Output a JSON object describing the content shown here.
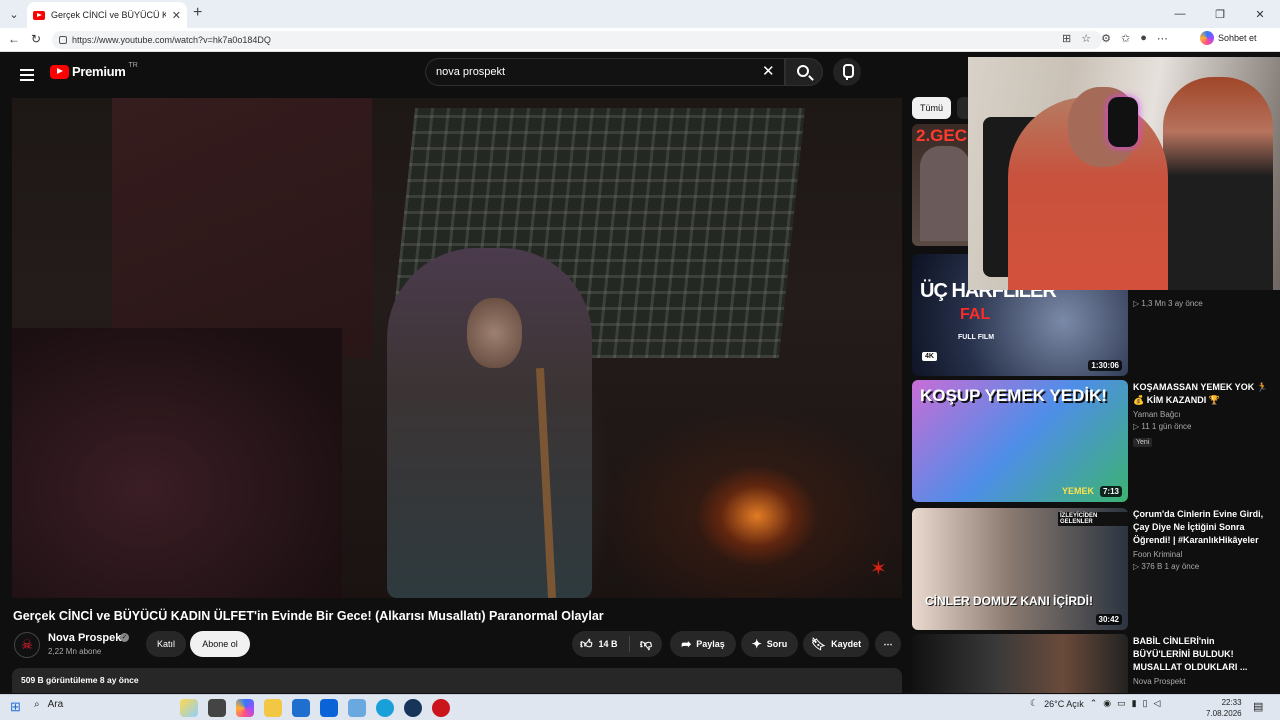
{
  "browser": {
    "tab_title": "Gerçek CİNCİ ve BÜYÜCÜ KADIN Ü",
    "url": "https://www.youtube.com/watch?v=hk7a0o184DQ",
    "copilot_label": "Sohbet et"
  },
  "header": {
    "logo_text": "Premium",
    "region": "TR",
    "search_value": "nova prospekt"
  },
  "video": {
    "title": "Gerçek CİNCİ ve BÜYÜCÜ KADIN ÜLFET'in Evinde Bir Gece! (Alkarısı Musallatı) Paranormal Olaylar",
    "channel_name": "Nova Prospekt",
    "subscribers": "2,22 Mn abone",
    "join_label": "Katıl",
    "subscribe_label": "Abone ol",
    "likes": "14 B",
    "share_label": "Paylaş",
    "ask_label": "Soru",
    "save_label": "Kaydet",
    "views_line": "509 B görüntüleme  8 ay önce"
  },
  "sidebar": {
    "chip_all": "Tümü",
    "recommendations": [
      {
        "thumb_text": "2.GECE",
        "title": "",
        "channel": "",
        "stats": "",
        "duration": ""
      },
      {
        "thumb_text": "ÜÇ HARFLİLER",
        "thumb_sub": "FAL",
        "thumb_sub2": "FULL FILM",
        "badge": "4K",
        "title": "",
        "channel": "",
        "stats": "1,3 Mn  3 ay önce",
        "duration": "1:30:06"
      },
      {
        "thumb_text": "KOŞUP YEMEK YEDİK!",
        "thumb_sub": "YEMEK",
        "title": "KOŞAMASSAN YEMEK YOK 🏃 💰 KİM KAZANDI 🏆",
        "channel": "Yaman Bağcı",
        "stats": "11  1 gün önce",
        "tag": "Yeni",
        "duration": "7:13"
      },
      {
        "thumb_text": "CİNLER DOMUZ KANI İÇİRDİ!",
        "thumb_sub": "İZLEYİCİDEN GELENLER",
        "title": "Çorum'da Cinlerin Evine Girdi, Çay Diye Ne İçtiğini Sonra Öğrendi! | #KaranlıkHikâyeler",
        "channel": "Foon Kriminal",
        "stats": "376 B  1 ay önce",
        "duration": "30:42"
      },
      {
        "title": "BABİL CİNLERİ'nin BÜYÜ'LERİNİ BULDUK! MUSALLAT OLDUKLARI ...",
        "channel": "Nova Prospekt"
      }
    ]
  },
  "taskbar": {
    "search_label": "Ara",
    "weather": "26°C  Açık",
    "time": "22:33",
    "date": "7.08.2026"
  }
}
